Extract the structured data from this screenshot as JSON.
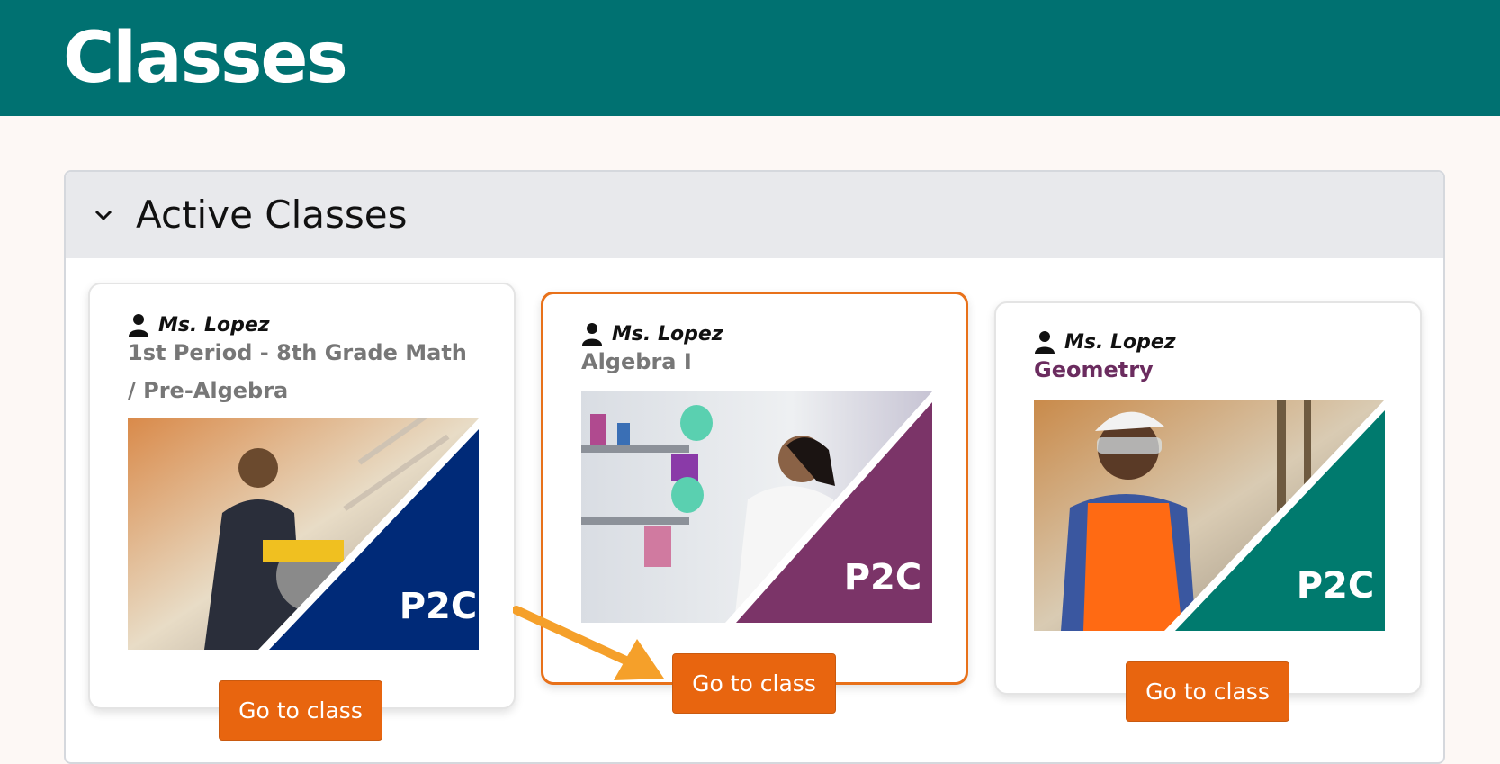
{
  "header": {
    "title": "Classes",
    "bg_color": "#007171"
  },
  "section": {
    "title": "Active Classes",
    "toggle_icon": "chevron-down-icon"
  },
  "classes": [
    {
      "teacher": "Ms. Lopez",
      "course": "1st Period - 8th Grade Math / Pre-Algebra",
      "button": "Go to class",
      "image": "woman-using-circular-saw-photo",
      "accent_color": "#002a78"
    },
    {
      "teacher": "Ms. Lopez",
      "course": "Algebra I",
      "button": "Go to class",
      "image": "scientist-in-lab-photo",
      "accent_color": "#7b3468",
      "selected": true
    },
    {
      "teacher": "Ms. Lopez",
      "course": "Geometry",
      "button": "Go to class",
      "image": "construction-worker-photo",
      "accent_color": "#007a6e"
    }
  ],
  "brand": {
    "logo_text": "P2C"
  },
  "colors": {
    "button": "#e8650f",
    "selected_border": "#e8711a",
    "annotation_arrow": "#f5a02a"
  }
}
